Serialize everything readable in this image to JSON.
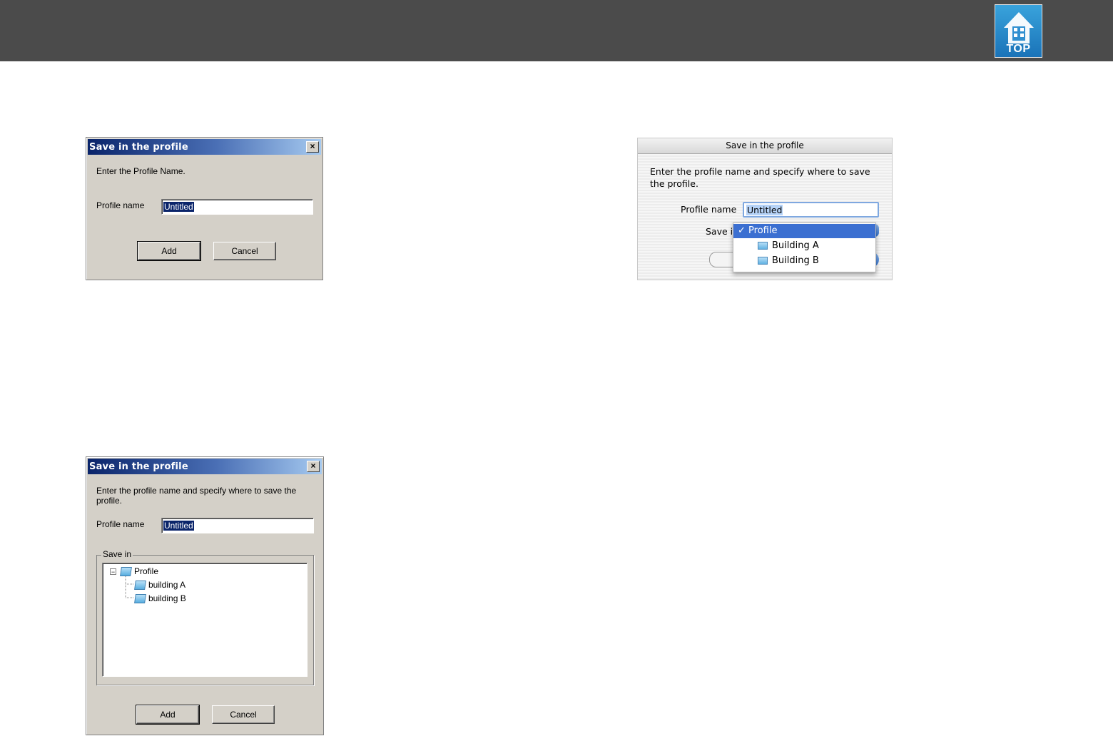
{
  "header": {
    "top_label": "TOP",
    "colors": {
      "bar": "#4b4b4b",
      "top_button": "#1a73b8"
    }
  },
  "dialog1": {
    "title": "Save in the profile",
    "close_glyph": "×",
    "message": "Enter the Profile Name.",
    "profile_label": "Profile name",
    "profile_value": "Untitled",
    "add_label": "Add",
    "cancel_label": "Cancel"
  },
  "dialog2": {
    "title": "Save in the profile",
    "close_glyph": "×",
    "message": "Enter the profile name and specify where to save the profile.",
    "profile_label": "Profile name",
    "profile_value": "Untitled",
    "save_in_label": "Save in",
    "tree": {
      "root": "Profile",
      "expander": "−",
      "children": [
        "building A",
        "building B"
      ]
    },
    "add_label": "Add",
    "cancel_label": "Cancel"
  },
  "mac_dialog": {
    "title": "Save in the profile",
    "message_line1": "Enter the profile name and specify where to save",
    "message_line2": "the profile.",
    "profile_label": "Profile name",
    "profile_value": "Untitled",
    "save_in_label": "Save in",
    "menu": {
      "selected": "✓ Profile",
      "items": [
        "Building A",
        "Building B"
      ]
    }
  }
}
